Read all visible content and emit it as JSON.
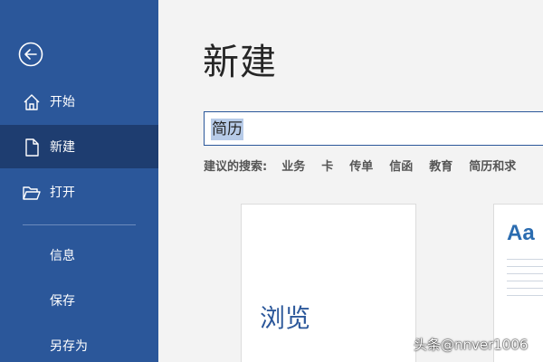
{
  "sidebar": {
    "items": [
      {
        "label": "开始"
      },
      {
        "label": "新建"
      },
      {
        "label": "打开"
      },
      {
        "label": "信息"
      },
      {
        "label": "保存"
      },
      {
        "label": "另存为"
      }
    ],
    "accent": "#2b579a",
    "active_bg": "#1e3d70"
  },
  "main": {
    "title": "新建",
    "search": {
      "value": "简历"
    },
    "suggestions": {
      "label": "建议的搜索:",
      "items": [
        "业务",
        "卡",
        "传单",
        "信函",
        "教育",
        "简历和求"
      ]
    },
    "templates": [
      {
        "label": "浏览"
      },
      {
        "label": "Aa"
      }
    ]
  },
  "watermark": "头条@nnver1006"
}
